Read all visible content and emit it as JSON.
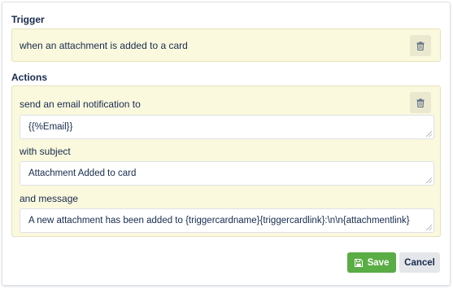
{
  "trigger": {
    "heading": "Trigger",
    "text": "when an attachment is added to a card",
    "delete_icon": "trash-icon"
  },
  "actions": {
    "heading": "Actions",
    "text": "send an email notification to",
    "delete_icon": "trash-icon",
    "to_value": "{{%Email}}",
    "subject_label": "with subject",
    "subject_value": "Attachment Added to card",
    "message_label": "and message",
    "message_value": "A new attachment has been added to {triggercardname}{triggercardlink}:\\n\\n{attachmentlink}"
  },
  "buttons": {
    "save_label": "Save",
    "save_icon": "floppy-disk-icon",
    "cancel_label": "Cancel"
  },
  "colors": {
    "panel_bg": "#faf8dd",
    "save_green": "#5aac44",
    "cancel_gray": "#e4e6ea"
  }
}
